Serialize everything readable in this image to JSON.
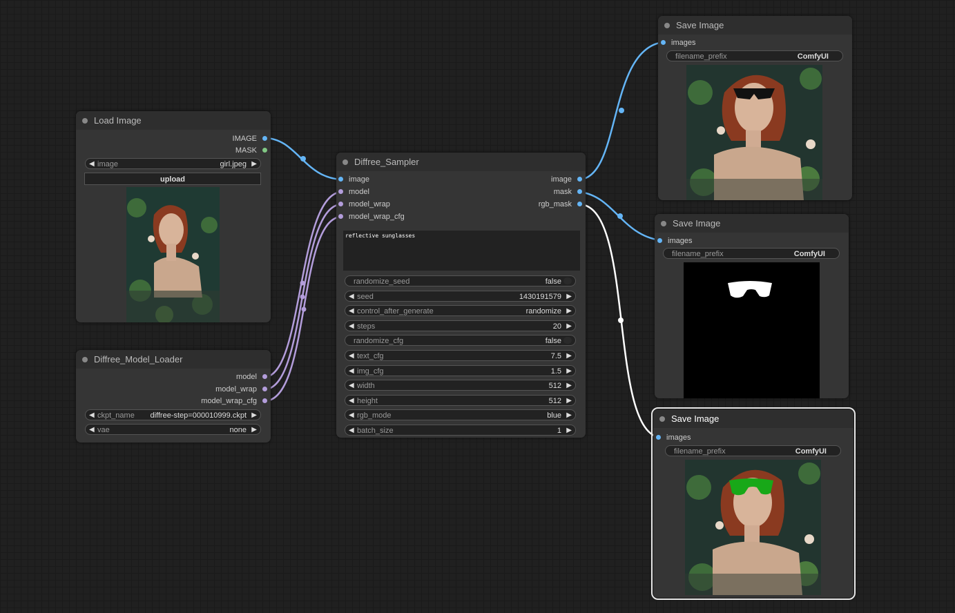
{
  "colors": {
    "canvas": "#202020",
    "node": "#353535",
    "image_link": "#64b5f6",
    "mask_link": "#81c784",
    "model_link": "#b39ddb",
    "rgb_mask_link": "#ffffff"
  },
  "load_image": {
    "title": "Load Image",
    "outputs": [
      "IMAGE",
      "MASK"
    ],
    "image_widget": {
      "label": "image",
      "value": "girl.jpeg"
    },
    "upload_label": "upload"
  },
  "model_loader": {
    "title": "Diffree_Model_Loader",
    "outputs": [
      "model",
      "model_wrap",
      "model_wrap_cfg"
    ],
    "ckpt_name": {
      "label": "ckpt_name",
      "value": "diffree-step=000010999.ckpt"
    },
    "vae": {
      "label": "vae",
      "value": "none"
    }
  },
  "sampler": {
    "title": "Diffree_Sampler",
    "inputs": [
      "image",
      "model",
      "model_wrap",
      "model_wrap_cfg"
    ],
    "outputs": [
      "image",
      "mask",
      "rgb_mask"
    ],
    "prompt": "reflective sunglasses",
    "widgets": [
      {
        "label": "randomize_seed",
        "value": "false",
        "kind": "toggle"
      },
      {
        "label": "seed",
        "value": "1430191579",
        "kind": "number"
      },
      {
        "label": "control_after_generate",
        "value": "randomize",
        "kind": "combo"
      },
      {
        "label": "steps",
        "value": "20",
        "kind": "number"
      },
      {
        "label": "randomize_cfg",
        "value": "false",
        "kind": "toggle"
      },
      {
        "label": "text_cfg",
        "value": "7.5",
        "kind": "number"
      },
      {
        "label": "img_cfg",
        "value": "1.5",
        "kind": "number"
      },
      {
        "label": "width",
        "value": "512",
        "kind": "number"
      },
      {
        "label": "height",
        "value": "512",
        "kind": "number"
      },
      {
        "label": "rgb_mode",
        "value": "blue",
        "kind": "combo"
      },
      {
        "label": "batch_size",
        "value": "1",
        "kind": "number"
      }
    ]
  },
  "save_nodes": [
    {
      "title": "Save Image",
      "input": "images",
      "prefix_label": "filename_prefix",
      "prefix_value": "ComfyUI",
      "preview": "sunglasses-result"
    },
    {
      "title": "Save Image",
      "input": "images",
      "prefix_label": "filename_prefix",
      "prefix_value": "ComfyUI",
      "preview": "mask-result"
    },
    {
      "title": "Save Image",
      "input": "images",
      "prefix_label": "filename_prefix",
      "prefix_value": "ComfyUI",
      "preview": "rgb-mask-result"
    }
  ]
}
